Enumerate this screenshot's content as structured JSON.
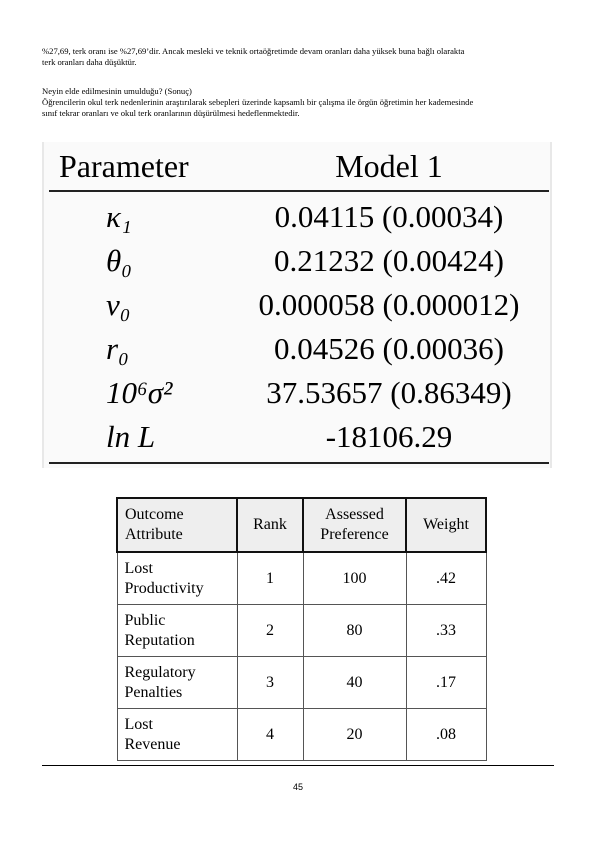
{
  "paragraph1": {
    "line1": "%27,69,  terk oranı ise %27,69’dir. Ancak mesleki ve teknik ortaöğretimde devam oranları daha yüksek buna bağlı olarakta",
    "line2": "terk oranları daha düşüktür."
  },
  "paragraph2": {
    "heading": "Neyin elde edilmesinin umulduğu? (Sonuç)",
    "line1": "Öğrencilerin okul terk nedenlerinin araştırılarak sebepleri üzerinde kapsamlı bir çalışma ile örgün öğretimin her kademesinde",
    "line2": "sınıf tekrar oranları ve okul terk oranlarının düşürülmesi hedeflenmektedir."
  },
  "param_table": {
    "headers": [
      "Parameter",
      "Model 1"
    ],
    "rows": [
      {
        "param": "κ₁",
        "value": "0.04115 (0.00034)"
      },
      {
        "param": "θ₀",
        "value": "0.21232 (0.00424)"
      },
      {
        "param": "v₀",
        "value": "0.000058 (0.000012)"
      },
      {
        "param": "r₀",
        "value": "0.04526 (0.00036)"
      },
      {
        "param": "10⁶σ²",
        "value": "37.53657 (0.86349)"
      },
      {
        "param": "ln L",
        "value": "-18106.29"
      }
    ]
  },
  "outcome_table": {
    "headers": {
      "attr_line1": "Outcome",
      "attr_line2": "Attribute",
      "rank": "Rank",
      "pref_line1": "Assessed",
      "pref_line2": "Preference",
      "weight": "Weight"
    },
    "rows": [
      {
        "attr1": "Lost",
        "attr2": "Productivity",
        "rank": "1",
        "pref": "100",
        "weight": ".42"
      },
      {
        "attr1": "Public",
        "attr2": "Reputation",
        "rank": "2",
        "pref": "80",
        "weight": ".33"
      },
      {
        "attr1": "Regulatory",
        "attr2": "Penalties",
        "rank": "3",
        "pref": "40",
        "weight": ".17"
      },
      {
        "attr1": "Lost",
        "attr2": "Revenue",
        "rank": "4",
        "pref": "20",
        "weight": ".08"
      }
    ]
  },
  "footer": {
    "page_number": "45"
  }
}
